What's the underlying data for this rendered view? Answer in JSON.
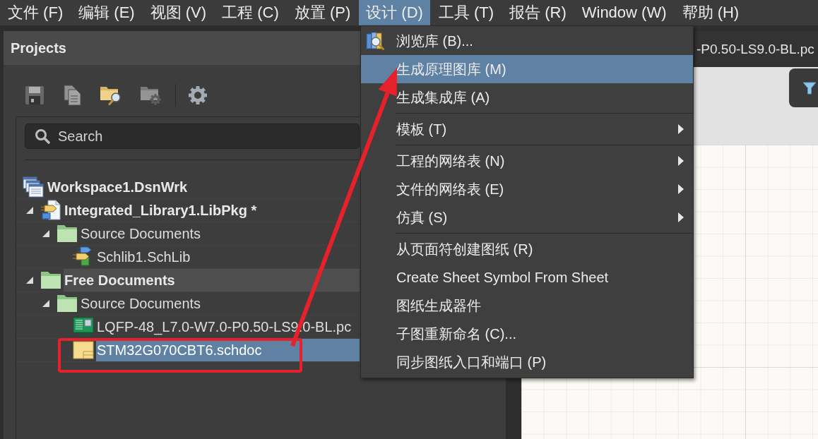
{
  "menu_bar": {
    "items": [
      {
        "label": "文件 (F)",
        "selected": false
      },
      {
        "label": "编辑 (E)",
        "selected": false
      },
      {
        "label": "视图 (V)",
        "selected": false
      },
      {
        "label": "工程 (C)",
        "selected": false
      },
      {
        "label": "放置 (P)",
        "selected": false
      },
      {
        "label": "设计 (D)",
        "selected": true
      },
      {
        "label": "工具 (T)",
        "selected": false
      },
      {
        "label": "报告 (R)",
        "selected": false
      },
      {
        "label": "Window (W)",
        "selected": false
      },
      {
        "label": "帮助 (H)",
        "selected": false
      }
    ]
  },
  "projects_panel": {
    "title": "Projects",
    "toolbar": [
      {
        "kind": "button",
        "disabled": true
      },
      {
        "kind": "button",
        "disabled": true
      },
      {
        "kind": "button",
        "disabled": false
      },
      {
        "kind": "button",
        "disabled": true
      },
      {
        "kind": "separator"
      },
      {
        "kind": "button",
        "disabled": false
      }
    ],
    "search": {
      "placeholder": "Search"
    },
    "tree": {
      "workspace": {
        "label": "Workspace1.DsnWrk",
        "selected": false
      },
      "projects": [
        {
          "kind": "library_package",
          "label": "Integrated_Library1.LibPkg *",
          "expanded": true,
          "focused": false,
          "selected": false,
          "children": [
            {
              "kind": "folder",
              "label": "Source Documents",
              "expanded": true,
              "selected": false,
              "children": [
                {
                  "kind": "schematic_library",
                  "label": "Schlib1.SchLib",
                  "selected": false
                }
              ]
            }
          ]
        },
        {
          "kind": "folder",
          "label": "Free Documents",
          "expanded": true,
          "focused": true,
          "selected": false,
          "children": [
            {
              "kind": "folder",
              "label": "Source Documents",
              "expanded": true,
              "selected": false,
              "children": [
                {
                  "kind": "pcb_library",
                  "label": "LQFP-48_L7.0-W7.0-P0.50-LS9.0-BL.pc",
                  "selected": false
                },
                {
                  "kind": "schematic",
                  "label": "STM32G070CBT6.schdoc",
                  "selected": true
                }
              ]
            }
          ]
        }
      ]
    }
  },
  "design_menu": {
    "items": [
      {
        "kind": "item",
        "label": "浏览库 (B)...",
        "has_icon": true,
        "has_submenu": false,
        "selected": false
      },
      {
        "kind": "item",
        "label": "生成原理图库 (M)",
        "has_icon": false,
        "has_submenu": false,
        "selected": true
      },
      {
        "kind": "item",
        "label": "生成集成库 (A)",
        "has_icon": false,
        "has_submenu": false,
        "selected": false
      },
      {
        "kind": "separator"
      },
      {
        "kind": "item",
        "label": "模板 (T)",
        "has_icon": false,
        "has_submenu": true,
        "selected": false
      },
      {
        "kind": "separator"
      },
      {
        "kind": "item",
        "label": "工程的网络表 (N)",
        "has_icon": false,
        "has_submenu": true,
        "selected": false
      },
      {
        "kind": "item",
        "label": "文件的网络表 (E)",
        "has_icon": false,
        "has_submenu": true,
        "selected": false
      },
      {
        "kind": "item",
        "label": "仿真 (S)",
        "has_icon": false,
        "has_submenu": true,
        "selected": false
      },
      {
        "kind": "separator"
      },
      {
        "kind": "item",
        "label": "从页面符创建图纸 (R)",
        "has_icon": false,
        "has_submenu": false,
        "selected": false
      },
      {
        "kind": "item",
        "label": "Create Sheet Symbol From Sheet",
        "has_icon": false,
        "has_submenu": false,
        "selected": false
      },
      {
        "kind": "item",
        "label": "图纸生成器件",
        "has_icon": false,
        "has_submenu": false,
        "selected": false
      },
      {
        "kind": "item",
        "label": "子图重新命名 (C)...",
        "has_icon": false,
        "has_submenu": false,
        "selected": false
      },
      {
        "kind": "item",
        "label": "同步图纸入口和端口 (P)",
        "has_icon": false,
        "has_submenu": false,
        "selected": false
      }
    ]
  },
  "document": {
    "tab": {
      "title": "-P0.50-LS9.0-BL.pc"
    }
  }
}
